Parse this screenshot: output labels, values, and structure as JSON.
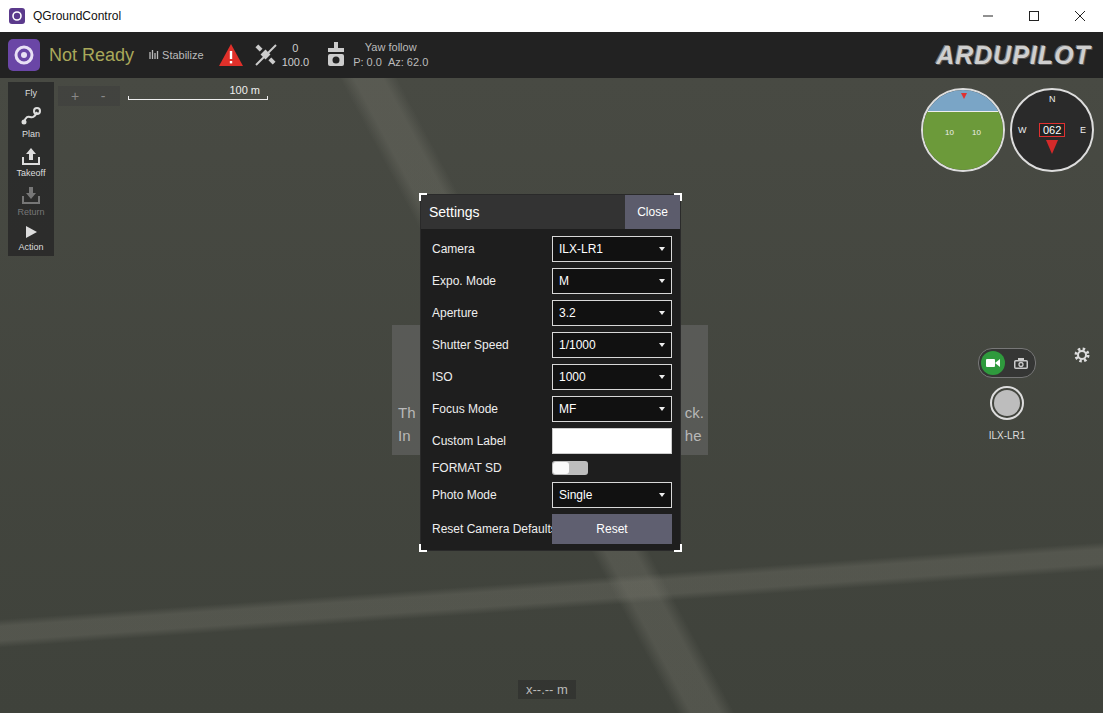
{
  "window": {
    "title": "QGroundControl"
  },
  "toolbar": {
    "status": "Not Ready",
    "mode": "Stabilize",
    "gps": {
      "count": "0",
      "hdop": "100.0"
    },
    "gimbal": {
      "mode": "Yaw follow",
      "pitch": "P: 0.0",
      "azimuth": "Az: 62.0"
    },
    "logo": "ARDUPILOT"
  },
  "tools": [
    {
      "label": "Fly",
      "kind": "label",
      "disabled": false
    },
    {
      "label": "Plan",
      "kind": "plan",
      "disabled": false
    },
    {
      "label": "Takeoff",
      "kind": "takeoff",
      "disabled": false
    },
    {
      "label": "Return",
      "kind": "return",
      "disabled": true
    },
    {
      "label": "Action",
      "kind": "action",
      "disabled": false
    }
  ],
  "map": {
    "zoom_in": "+",
    "zoom_out": "-",
    "scale": "100 m",
    "distance": "x--.-- m"
  },
  "instruments": {
    "attitude": {
      "ticks": [
        "10",
        "10"
      ]
    },
    "compass": {
      "heading": "062",
      "north": "N",
      "east": "E",
      "west": "W"
    }
  },
  "camera": {
    "name": "ILX-LR1",
    "modes": [
      {
        "kind": "video",
        "selected": true
      },
      {
        "kind": "photo",
        "selected": false
      }
    ]
  },
  "behind": {
    "left": [
      "Th",
      "In"
    ],
    "right": [
      "ck.",
      "he"
    ]
  },
  "dialog": {
    "title": "Settings",
    "close": "Close",
    "rows": [
      {
        "kind": "select",
        "label": "Camera",
        "value": "ILX-LR1"
      },
      {
        "kind": "select",
        "label": "Expo. Mode",
        "value": "M"
      },
      {
        "kind": "select",
        "label": "Aperture",
        "value": "3.2"
      },
      {
        "kind": "select",
        "label": "Shutter Speed",
        "value": "1/1000"
      },
      {
        "kind": "select",
        "label": "ISO",
        "value": "1000"
      },
      {
        "kind": "select",
        "label": "Focus Mode",
        "value": "MF"
      },
      {
        "kind": "text",
        "label": "Custom Label",
        "value": ""
      },
      {
        "kind": "toggle",
        "label": "FORMAT SD",
        "on": false
      },
      {
        "kind": "select",
        "label": "Photo Mode",
        "value": "Single"
      },
      {
        "kind": "button",
        "label": "Reset Camera Defaults",
        "value": "Reset"
      }
    ]
  }
}
